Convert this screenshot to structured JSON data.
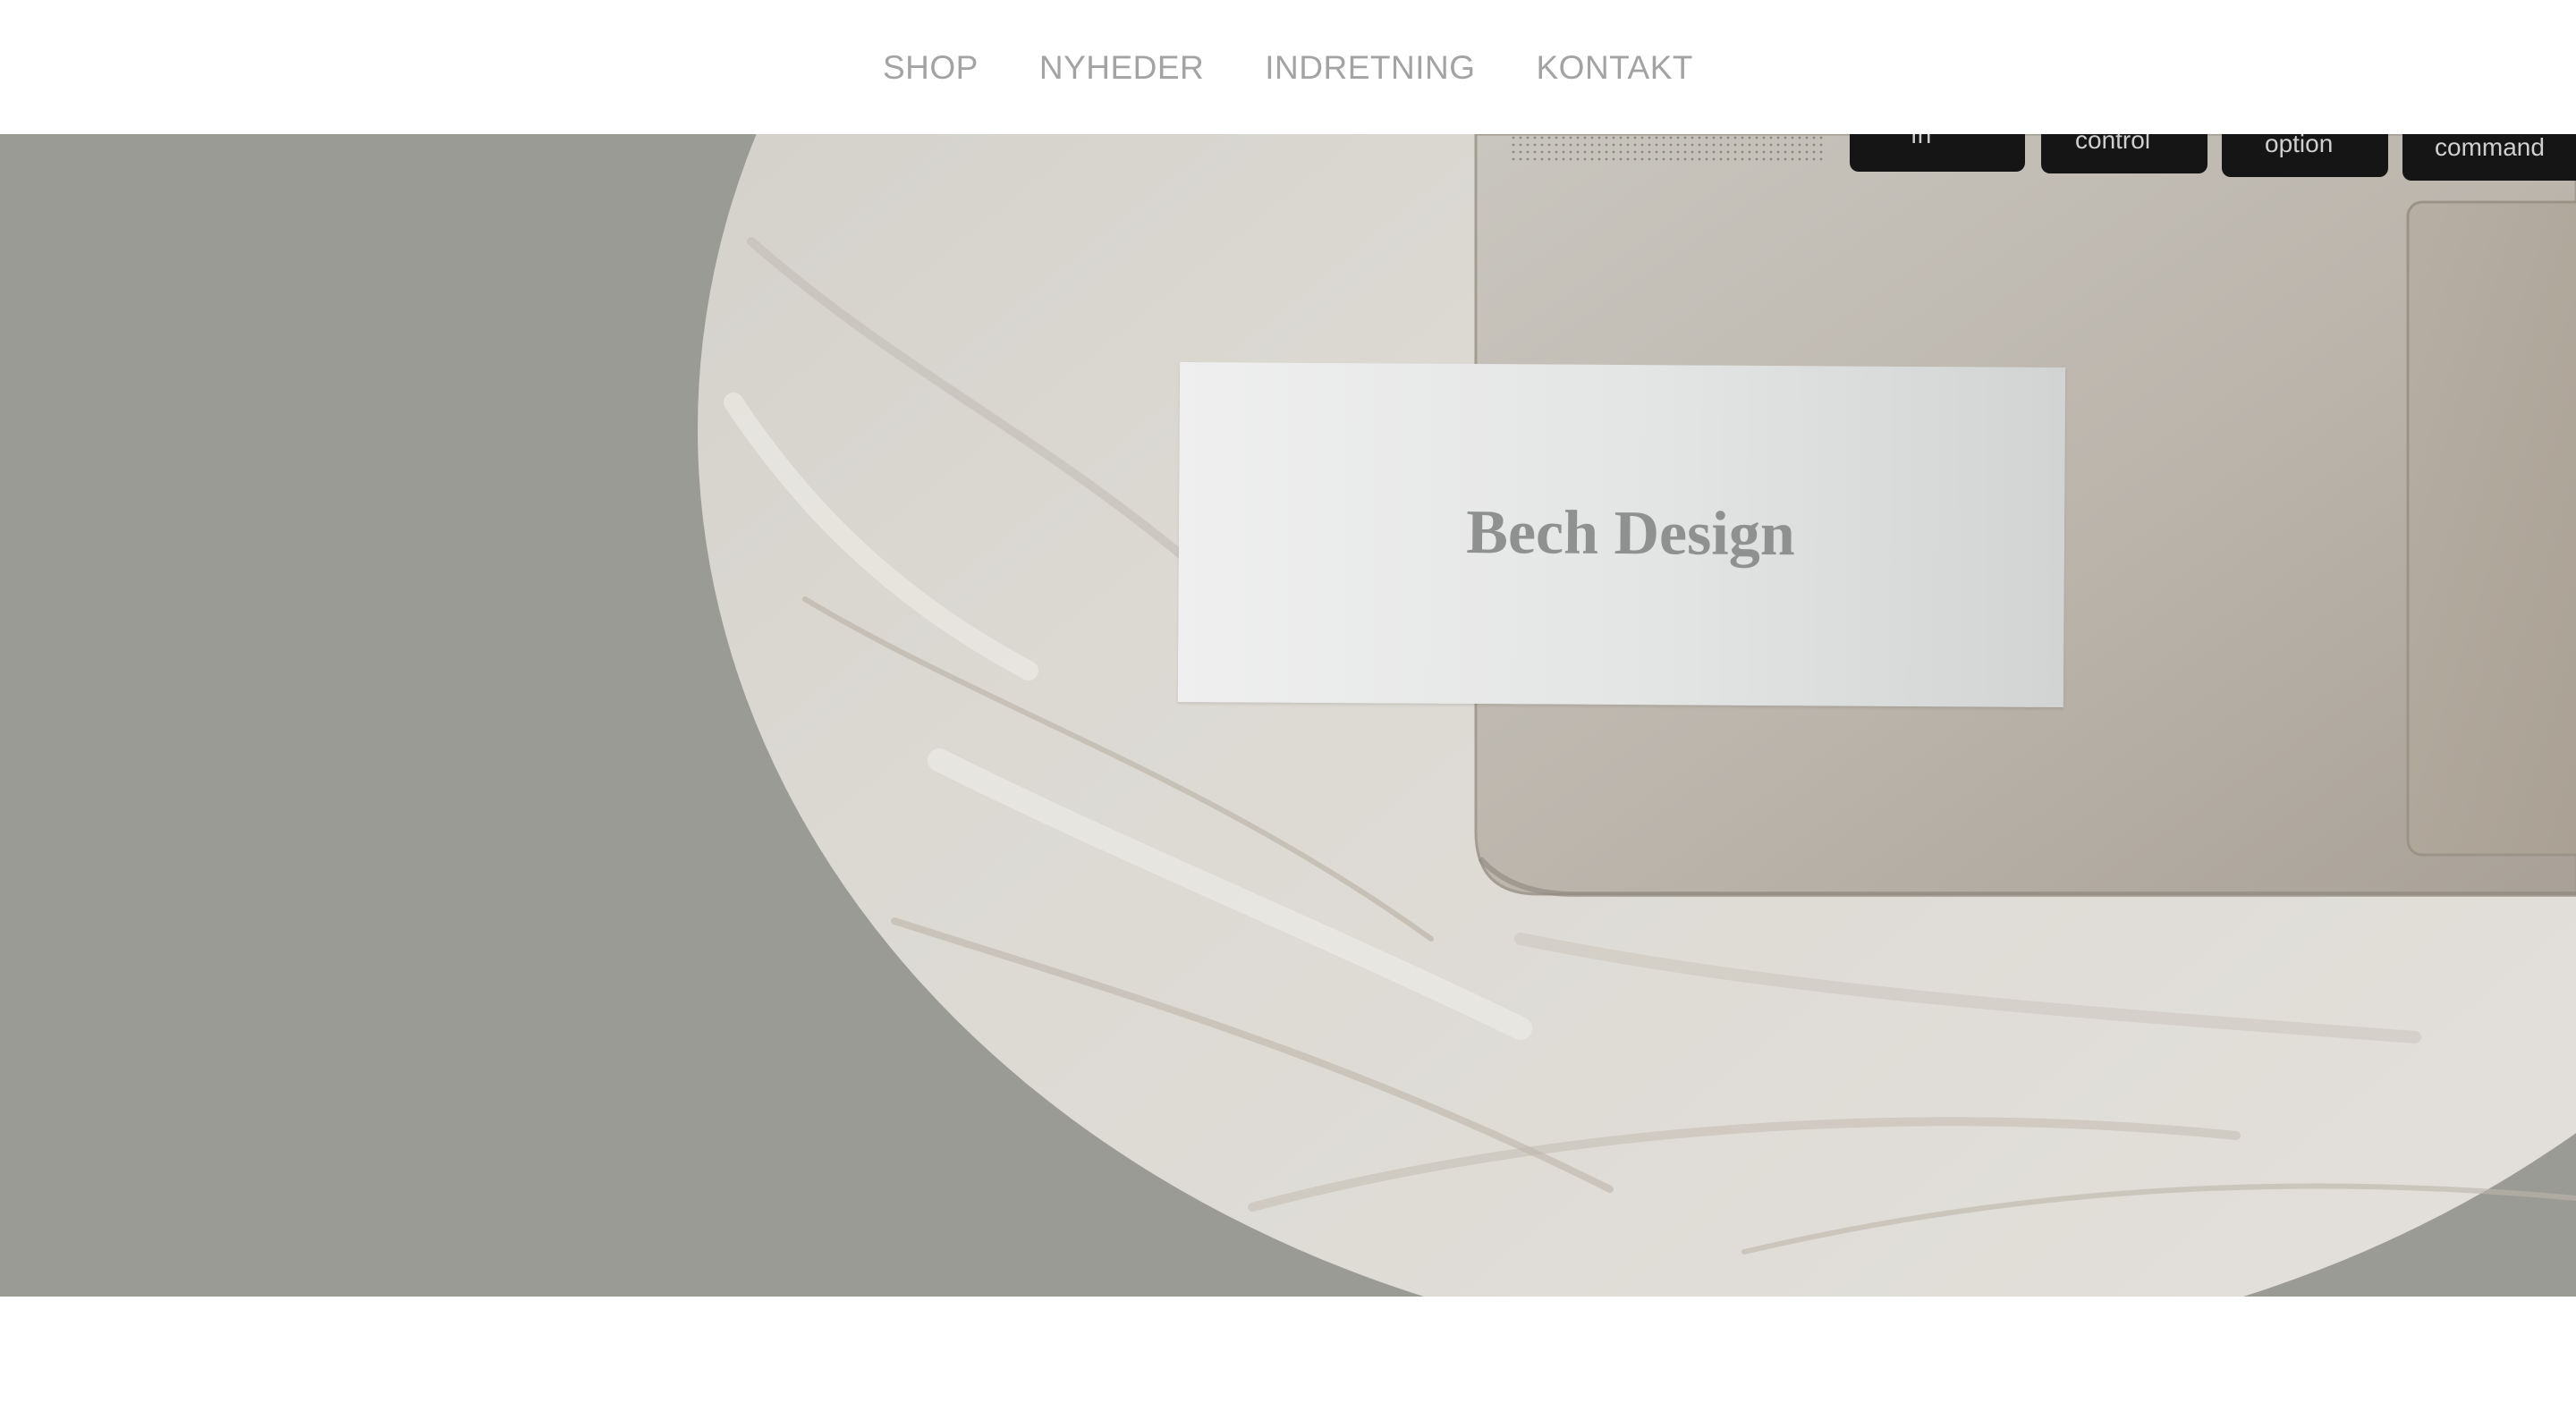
{
  "nav": {
    "items": [
      {
        "label": "SHOP"
      },
      {
        "label": "NYHEDER"
      },
      {
        "label": "INDRETNING"
      },
      {
        "label": "KONTAKT"
      }
    ]
  },
  "hero": {
    "card_text": "Bech Design",
    "keyboard_keys": {
      "fn": "fn",
      "control": "control",
      "option": "option",
      "command": "command"
    }
  },
  "colors": {
    "nav_text": "#a3a3a3",
    "hero_background": "#9b9b96",
    "marble": "#d9d6d0",
    "laptop": "#bdb8b0",
    "card": "#e6e7e7",
    "card_text": "#8f9190"
  }
}
